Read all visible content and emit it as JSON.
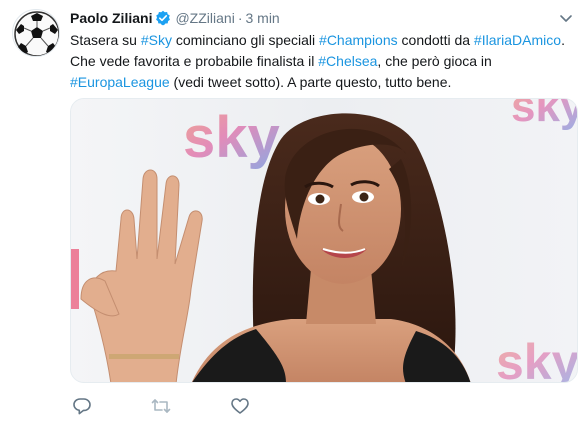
{
  "tweet": {
    "author_name": "Paolo Ziliani",
    "handle": "@ZZiliani",
    "separator": "·",
    "time": "3 min",
    "text_segments": [
      {
        "t": "Stasera su ",
        "tag": false
      },
      {
        "t": "#Sky",
        "tag": true
      },
      {
        "t": " cominciano gli speciali ",
        "tag": false
      },
      {
        "t": "#Champions",
        "tag": true
      },
      {
        "t": " condotti da ",
        "tag": false
      },
      {
        "t": "#IlariaDAmico",
        "tag": true
      },
      {
        "t": ". Che vede favorita e probabile finalista il ",
        "tag": false
      },
      {
        "t": "#Chelsea",
        "tag": true
      },
      {
        "t": ", che però gioca in ",
        "tag": false
      },
      {
        "t": "#EuropaLeague",
        "tag": true
      },
      {
        "t": " (vedi tweet sotto). A parte questo, tutto bene.",
        "tag": false
      }
    ],
    "media": {
      "backdrop_logo": "sky"
    }
  },
  "icons": {
    "avatar": "soccer-ball-icon",
    "verified": "verified-badge-icon",
    "caret": "chevron-down-icon",
    "reply": "reply-icon",
    "retweet": "retweet-icon",
    "like": "heart-icon"
  },
  "colors": {
    "link": "#1b95e0",
    "muted": "#657786",
    "verified": "#1da1f2",
    "action_icon": "#657786",
    "retweet_disabled": "#aab8c2"
  }
}
